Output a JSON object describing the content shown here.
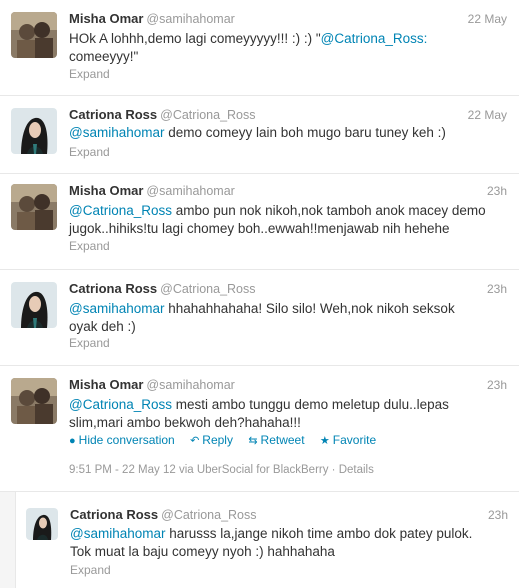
{
  "tweets": [
    {
      "name": "Misha Omar",
      "handle": "@samihahomar",
      "time": "22 May",
      "line1_a": "HOk A lohhh,demo lagi comeyyyyy!!! :) :) \"",
      "line1_m": "@Catriona_Ross",
      "line1_b": ":",
      "line2": "comeeyyy!\"",
      "expand": "Expand"
    },
    {
      "name": "Catriona Ross",
      "handle": "@Catriona_Ross",
      "time": "22 May",
      "line1_m": "@samihahomar",
      "line1_b": " demo comeyy lain boh mugo baru tuney keh :)",
      "expand": "Expand"
    },
    {
      "name": "Misha Omar",
      "handle": "@samihahomar",
      "time": "23h",
      "line1_m": "@Catriona_Ross",
      "line1_b": " ambo pun nok nikoh,nok tamboh anok macey demo",
      "line2": "jugok..hihiks!tu lagi chomey boh..ewwah!!menjawab nih hehehe",
      "expand": "Expand"
    },
    {
      "name": "Catriona Ross",
      "handle": "@Catriona_Ross",
      "time": "23h",
      "line1_m": "@samihahomar",
      "line1_b": " hhahahhahaha! Silo silo! Weh,nok nikoh seksok",
      "line2": "oyak deh :)",
      "expand": "Expand"
    },
    {
      "name": "Misha Omar",
      "handle": "@samihahomar",
      "time": "23h",
      "line1_m": "@Catriona_Ross",
      "line1_b": " mesti ambo tunggu demo meletup dulu..lepas",
      "line2": "slim,mari ambo bekwoh deh?hahaha!!!",
      "actions": {
        "hide": "Hide conversation",
        "reply": "Reply",
        "retweet": "Retweet",
        "favorite": "Favorite"
      },
      "meta": "9:51 PM - 22 May 12 via UberSocial for BlackBerry · Details"
    },
    {
      "name": "Catriona Ross",
      "handle": "@Catriona_Ross",
      "time": "23h",
      "line1_m": "@samihahomar",
      "line1_b": " harusss la,jange nikoh time ambo dok patey pulok.",
      "line2": "Tok muat la baju comeyy nyoh :) hahhahaha",
      "expand": "Expand"
    }
  ],
  "icons": {
    "hide": "speech-bubble-icon",
    "reply": "reply-arrow-icon",
    "retweet": "retweet-icon",
    "favorite": "star-icon"
  },
  "colors": {
    "link": "#0084b4",
    "muted": "#999999",
    "text": "#333333"
  }
}
